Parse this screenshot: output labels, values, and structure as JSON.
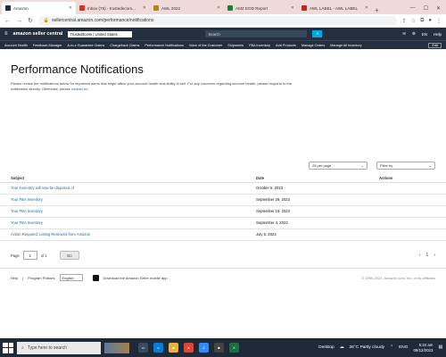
{
  "browser": {
    "tabs": [
      {
        "label": "Amazon",
        "color": "#232f3e",
        "active": true
      },
      {
        "label": "Inbox (75) - trustedecom...",
        "color": "#d93025",
        "active": false
      },
      {
        "label": "AWL 2022",
        "color": "#a68b24",
        "active": false
      },
      {
        "label": "AMZ EOD Report",
        "color": "#188038",
        "active": false
      },
      {
        "label": "AWL LABEL - AWL LABEL",
        "color": "#c5221f",
        "active": false
      }
    ],
    "url": "sellercentral.amazon.com/performance/notifications",
    "new_tab": "+"
  },
  "header": {
    "logo": "amazon seller central",
    "marketplace": "TrustedEcom | United States",
    "search_placeholder": "Search",
    "language": "EN",
    "help": "Help"
  },
  "nav": {
    "items": [
      "Account Health",
      "Feedback Manager",
      "A-to-z Guarantee Claims",
      "Chargeback Claims",
      "Performance Notifications",
      "Voice of the Customer",
      "Shipments",
      "FBA Inventory",
      "Add Products",
      "Manage Orders",
      "Manage All Inventory"
    ],
    "edit": "Edit"
  },
  "page": {
    "title": "Performance Notifications",
    "description": "Please review the notifications below for important alerts that might affect your account health and ability to sell. For any concerns regarding account health, please respond to the notification directly. Otherwise, please",
    "contact_link": "contact us",
    "per_page": "25 per page",
    "filter_by": "Filter by"
  },
  "table": {
    "headers": [
      "Subject",
      "Date",
      "Actions"
    ],
    "rows": [
      {
        "subject": "Your inventory will now be disposed of",
        "date": "October 5, 2023"
      },
      {
        "subject": "Your FBA Inventory",
        "date": "September 29, 2023"
      },
      {
        "subject": "Your FBA Inventory",
        "date": "September 19, 2023"
      },
      {
        "subject": "Your FBA Inventory",
        "date": "September 4, 2023"
      },
      {
        "subject": "Action Required: Listing Removed from Amazon",
        "date": "July 5, 2023"
      }
    ]
  },
  "pager": {
    "page_label": "Page",
    "page_value": "1",
    "of_label": "of 1",
    "go": "Go",
    "current": "1"
  },
  "footer": {
    "help": "Help",
    "program_policies": "Program Policies",
    "language": "English",
    "mobile_app": "Download the Amazon Seller mobile app",
    "copyright": "© 1999-2023, Amazon.com, Inc. or its affiliates",
    "feedback": "FEEDBACK"
  },
  "taskbar": {
    "search_placeholder": "Type here to search",
    "desktop": "Desktop",
    "weather": "26°C  Partly cloudy",
    "lang": "ENG",
    "time": "5:34 am",
    "date": "09/12/2023"
  }
}
